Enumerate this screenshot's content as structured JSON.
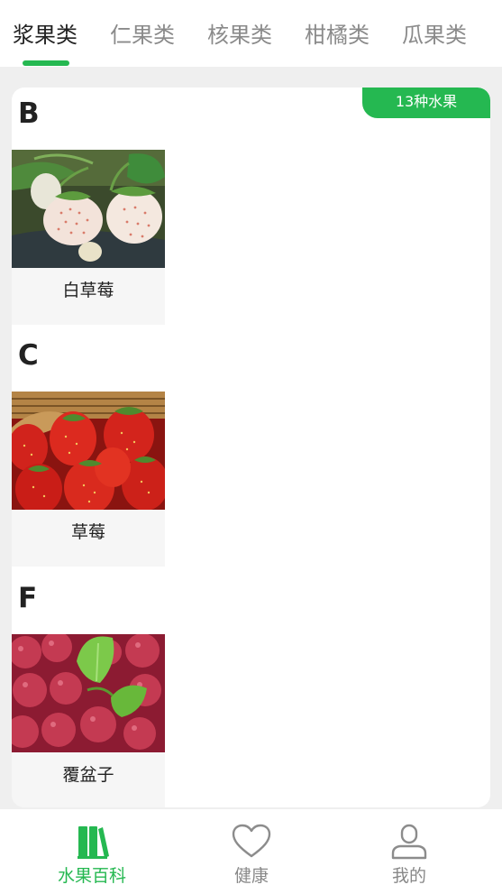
{
  "tabs": [
    "浆果类",
    "仁果类",
    "核果类",
    "柑橘类",
    "瓜果类"
  ],
  "active_tab": 0,
  "colors": {
    "accent": "#25b851",
    "background": "#efefef",
    "text_primary": "#222222",
    "text_secondary": "#888888"
  },
  "badge": {
    "count_label": "13种水果"
  },
  "groups": [
    {
      "letter": "B",
      "fruits": [
        {
          "name": "白草莓",
          "image": "white-strawberry-photo"
        }
      ]
    },
    {
      "letter": "C",
      "fruits": [
        {
          "name": "草莓",
          "image": "strawberry-photo"
        }
      ]
    },
    {
      "letter": "F",
      "fruits": [
        {
          "name": "覆盆子",
          "image": "raspberry-photo"
        }
      ]
    }
  ],
  "bottom_nav": [
    {
      "label": "水果百科",
      "icon": "book-icon",
      "active": true
    },
    {
      "label": "健康",
      "icon": "heart-icon",
      "active": false
    },
    {
      "label": "我的",
      "icon": "user-icon",
      "active": false
    }
  ]
}
